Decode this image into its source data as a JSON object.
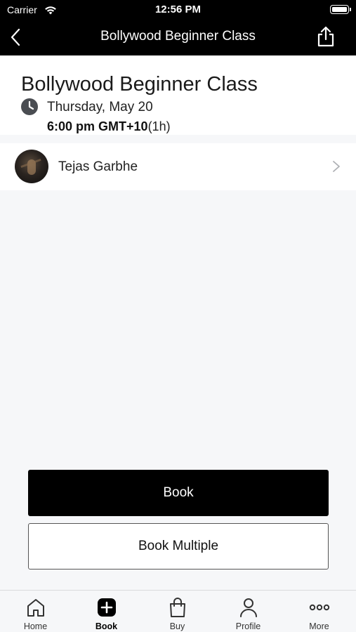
{
  "status_bar": {
    "carrier": "Carrier",
    "time": "12:56 PM"
  },
  "nav": {
    "title": "Bollywood Beginner Class",
    "back_icon": "chevron-left-icon",
    "share_icon": "share-icon"
  },
  "event": {
    "title": "Bollywood Beginner Class",
    "date": "Thursday, May 20",
    "time": "6:00 pm GMT+10",
    "duration": "(1h)"
  },
  "instructor": {
    "name": "Tejas Garbhe"
  },
  "actions": {
    "book_label": "Book",
    "book_multiple_label": "Book Multiple"
  },
  "tabs": [
    {
      "label": "Home",
      "icon": "home-icon",
      "active": false
    },
    {
      "label": "Book",
      "icon": "plus-square-icon",
      "active": true
    },
    {
      "label": "Buy",
      "icon": "shopping-bag-icon",
      "active": false
    },
    {
      "label": "Profile",
      "icon": "person-icon",
      "active": false
    },
    {
      "label": "More",
      "icon": "more-dots-icon",
      "active": false
    }
  ],
  "colors": {
    "nav_background": "#000000",
    "primary_button": "#000000",
    "page_background": "#f6f7f9"
  }
}
